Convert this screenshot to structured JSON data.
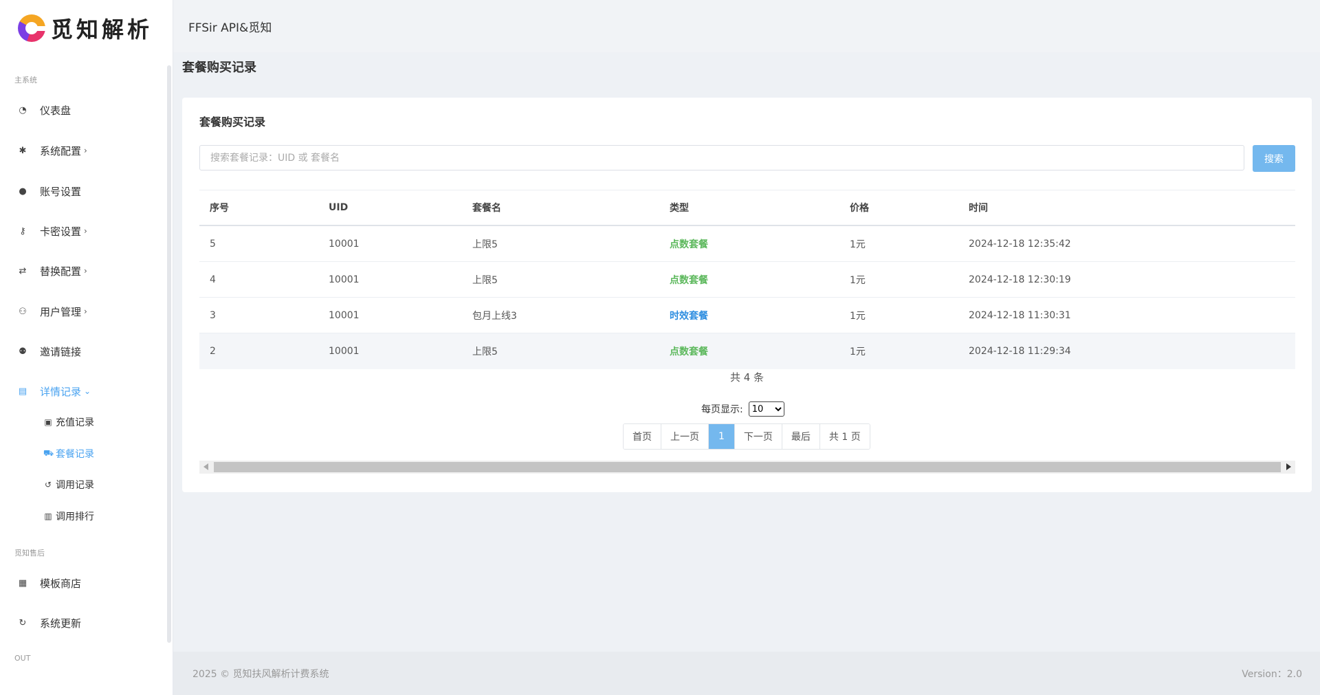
{
  "brand": {
    "name": "觅知解析"
  },
  "header": {
    "title": "FFSir API&觅知"
  },
  "sidebar": {
    "section_main": "主系统",
    "section_after": "觅知售后",
    "section_out": "OUT",
    "items": [
      {
        "label": "仪表盘",
        "icon": "dashboard-icon"
      },
      {
        "label": "系统配置",
        "icon": "gear-icon",
        "chevron": "›"
      },
      {
        "label": "账号设置",
        "icon": "user-icon"
      },
      {
        "label": "卡密设置",
        "icon": "key-icon",
        "chevron": "›"
      },
      {
        "label": "替换配置",
        "icon": "exchange-icon",
        "chevron": "›"
      },
      {
        "label": "用户管理",
        "icon": "users-icon",
        "chevron": "›"
      },
      {
        "label": "邀请链接",
        "icon": "user-plus-icon"
      },
      {
        "label": "详情记录",
        "icon": "clipboard-icon",
        "chevron": "⌄"
      }
    ],
    "sub_items": [
      {
        "label": "充值记录",
        "icon": "money-icon"
      },
      {
        "label": "套餐记录",
        "icon": "cart-icon"
      },
      {
        "label": "调用记录",
        "icon": "history-icon"
      },
      {
        "label": "调用排行",
        "icon": "bar-chart-icon"
      }
    ],
    "after_items": [
      {
        "label": "模板商店",
        "icon": "store-icon"
      },
      {
        "label": "系统更新",
        "icon": "refresh-icon"
      }
    ]
  },
  "page": {
    "heading": "套餐购买记录"
  },
  "card": {
    "title": "套餐购买记录",
    "search_placeholder": "搜索套餐记录：UID 或 套餐名",
    "search_button": "搜索"
  },
  "table": {
    "headers": [
      "序号",
      "UID",
      "套餐名",
      "类型",
      "价格",
      "时间"
    ],
    "rows": [
      [
        "5",
        "10001",
        "上限5",
        "点数套餐",
        "1元",
        "2024-12-18 12:35:42"
      ],
      [
        "4",
        "10001",
        "上限5",
        "点数套餐",
        "1元",
        "2024-12-18 12:30:19"
      ],
      [
        "3",
        "10001",
        "包月上线3",
        "时效套餐",
        "1元",
        "2024-12-18 11:30:31"
      ],
      [
        "2",
        "10001",
        "上限5",
        "点数套餐",
        "1元",
        "2024-12-18 11:29:34"
      ]
    ]
  },
  "colors": {
    "points_type": "#5cb85c",
    "time_type": "#2e8ee0",
    "accent": "#74b8ee",
    "active_nav": "#4aa3f0"
  },
  "pagination": {
    "total": "共 4 条",
    "per_page_label": "每页显示:",
    "per_page_value": "10",
    "first": "首页",
    "prev": "上一页",
    "current": "1",
    "next": "下一页",
    "last": "最后",
    "pages": "共 1 页"
  },
  "footer": {
    "copyright": "2025 © 觅知扶风解析计费系统",
    "version": "Version：2.0"
  }
}
